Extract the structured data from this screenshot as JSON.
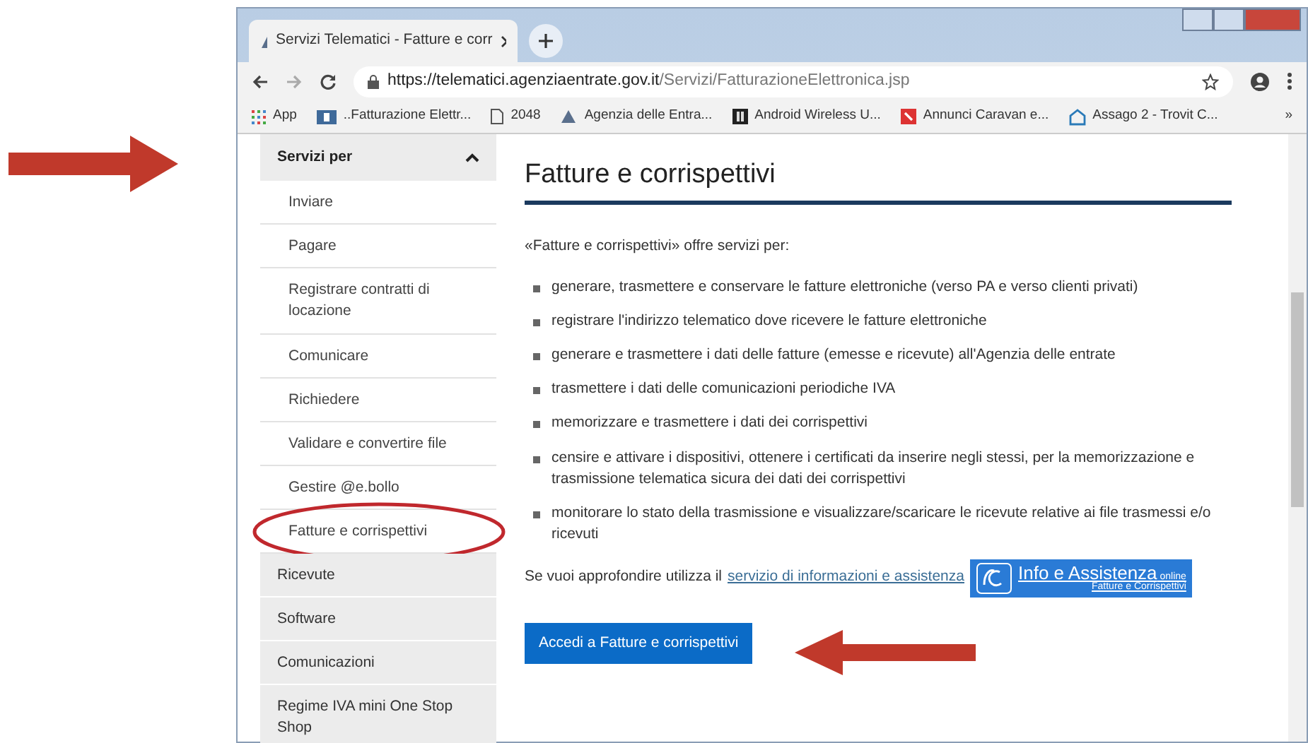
{
  "browser": {
    "tab_title": "Servizi Telematici - Fatture e corr",
    "url_host": "https://telematici.agenziaentrate.gov.it",
    "url_path": "/Servizi/FatturazioneElettronica.jsp",
    "bookmarks": [
      {
        "kind": "apps",
        "label": "App"
      },
      {
        "kind": "site",
        "label": "..Fatturazione Elettr..."
      },
      {
        "kind": "page",
        "label": "2048"
      },
      {
        "kind": "agency",
        "label": "Agenzia delle Entra..."
      },
      {
        "kind": "dark",
        "label": "Android Wireless U..."
      },
      {
        "kind": "red",
        "label": "Annunci Caravan e..."
      },
      {
        "kind": "home",
        "label": "Assago 2 - Trovit C..."
      }
    ],
    "more": "»"
  },
  "sidebar": {
    "header": "Servizi per",
    "expanded": true,
    "items": [
      {
        "kind": "sub",
        "label": "Inviare",
        "circled": false
      },
      {
        "kind": "sub",
        "label": "Pagare",
        "circled": false
      },
      {
        "kind": "sub",
        "label": "Registrare contratti di locazione",
        "circled": false
      },
      {
        "kind": "sub",
        "label": "Comunicare",
        "circled": false
      },
      {
        "kind": "sub",
        "label": "Richiedere",
        "circled": false
      },
      {
        "kind": "sub",
        "label": "Validare e convertire file",
        "circled": false
      },
      {
        "kind": "sub",
        "label": "Gestire @e.bollo",
        "circled": false
      },
      {
        "kind": "sub",
        "label": "Fatture e corrispettivi",
        "circled": true
      },
      {
        "kind": "top",
        "label": "Ricevute",
        "circled": false
      },
      {
        "kind": "top",
        "label": "Software",
        "circled": false
      },
      {
        "kind": "top",
        "label": "Comunicazioni",
        "circled": false
      },
      {
        "kind": "top",
        "label": "Regime IVA mini One Stop Shop",
        "circled": false
      }
    ]
  },
  "main": {
    "heading": "Fatture e corrispettivi",
    "intro": "«Fatture e corrispettivi» offre servizi per:",
    "bullets": [
      "generare, trasmettere e conservare le fatture elettroniche (verso PA e verso clienti privati)",
      "registrare l'indirizzo telematico dove ricevere le fatture elettroniche",
      "generare e trasmettere i dati delle fatture (emesse e ricevute) all'Agenzia delle entrate",
      "trasmettere i dati delle comunicazioni periodiche IVA",
      "memorizzare e trasmettere i dati dei corrispettivi",
      "censire e attivare i dispositivi, ottenere i certificati da inserire negli stessi, per la memorizzazione e trasmissione telematica sicura dei dati dei corrispettivi",
      "monitorare lo stato della trasmissione e visualizzare/scaricare le ricevute relative ai file trasmessi e/o ricevuti"
    ],
    "help_text": "Se vuoi approfondire utilizza il",
    "help_link": "servizio di informazioni e assistenza",
    "banner": {
      "title": "Info e Assistenza",
      "tag": "online",
      "subtitle": "Fatture e Corrispettivi"
    },
    "button": "Accedi a Fatture e corrispettivi"
  }
}
